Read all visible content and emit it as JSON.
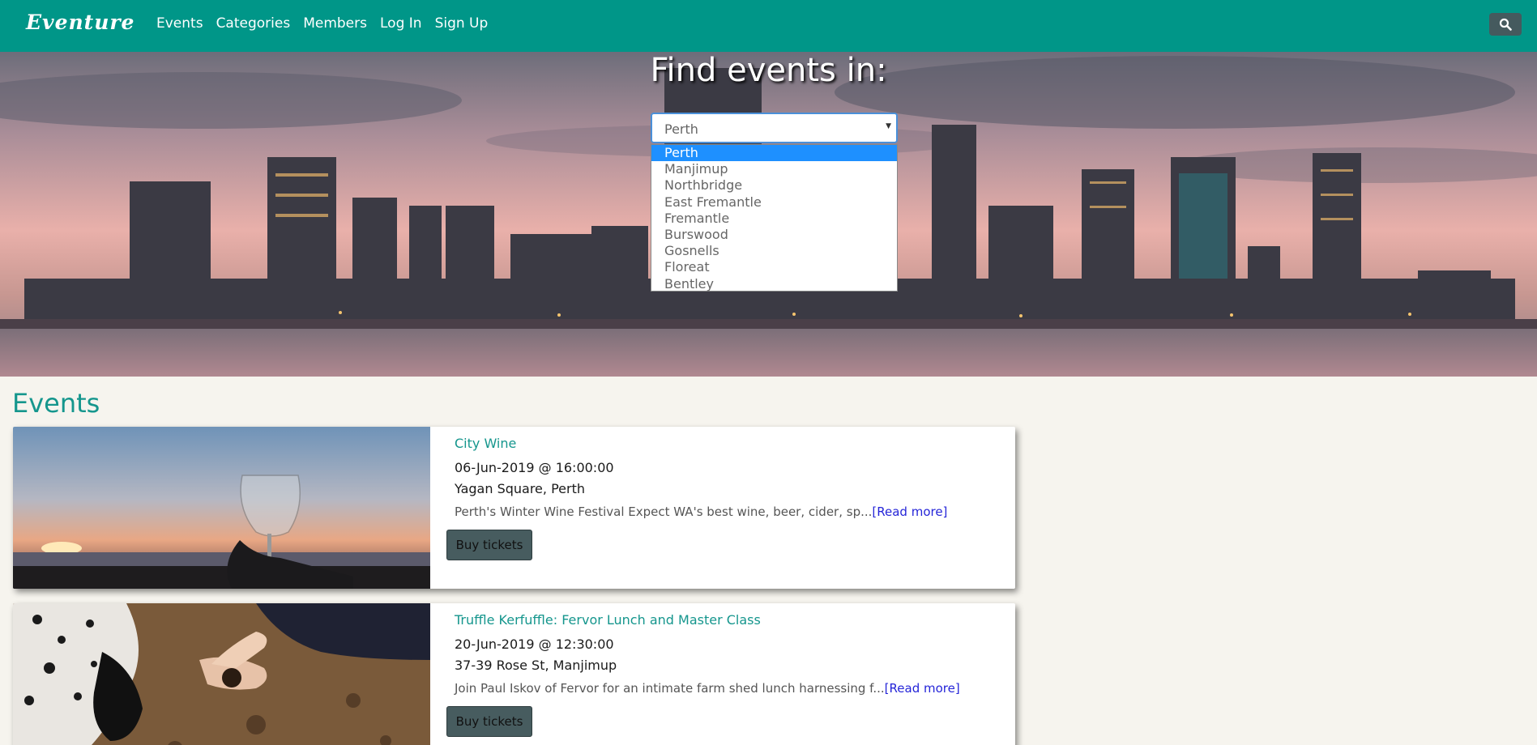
{
  "navbar": {
    "brand": "Eventure",
    "links": [
      "Events",
      "Categories",
      "Members",
      "Log In",
      "Sign Up"
    ],
    "search_icon": "search-icon",
    "color": "#009688"
  },
  "hero": {
    "title": "Find events in:",
    "select": {
      "selected": "Perth",
      "options": [
        "Perth",
        "Manjimup",
        "Northbridge",
        "East Fremantle",
        "Fremantle",
        "Burswood",
        "Gosnells",
        "Floreat",
        "Bentley"
      ]
    }
  },
  "events": {
    "heading": "Events",
    "items": [
      {
        "title": "City Wine",
        "date": "06-Jun-2019 @ 16:00:00",
        "location": "Yagan Square, Perth",
        "description": "Perth's Winter Wine Festival Expect WA's best wine, beer, cider, sp...",
        "read_more": "[Read more]",
        "button": "Buy tickets"
      },
      {
        "title": "Truffle Kerfuffle: Fervor Lunch and Master Class",
        "date": "20-Jun-2019 @ 12:30:00",
        "location": "37-39 Rose St, Manjimup",
        "description": "Join Paul Iskov of Fervor for an intimate farm shed lunch harnessing f...",
        "read_more": "[Read more]",
        "button": "Buy tickets"
      }
    ]
  }
}
